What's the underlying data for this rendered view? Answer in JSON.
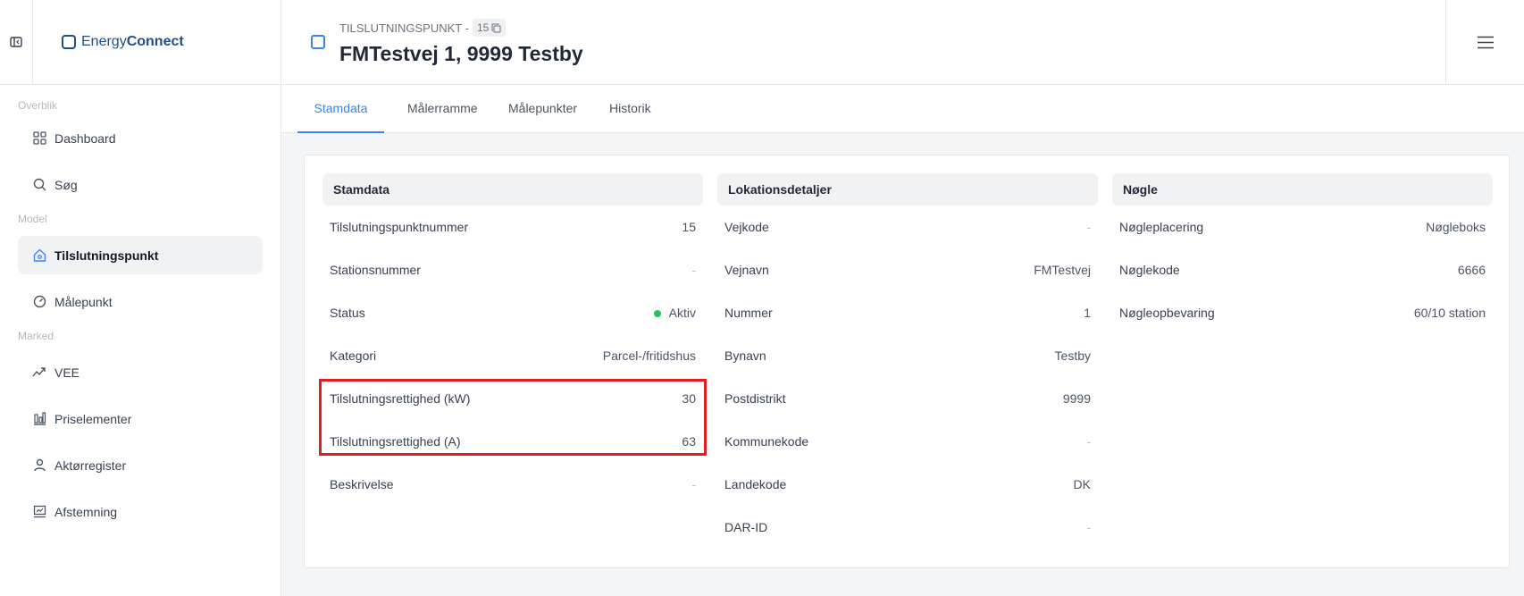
{
  "app": {
    "logo_light": "Energy",
    "logo_bold": "Connect"
  },
  "sidebar": {
    "sections": {
      "overview": "Overblik",
      "model": "Model",
      "market": "Marked"
    },
    "items": [
      {
        "label": "Dashboard",
        "icon": "grid-icon"
      },
      {
        "label": "Søg",
        "icon": "search-icon"
      },
      {
        "label": "Tilslutningspunkt",
        "icon": "home-icon",
        "active": true
      },
      {
        "label": "Målepunkt",
        "icon": "gauge-icon"
      },
      {
        "label": "VEE",
        "icon": "trend-icon"
      },
      {
        "label": "Priselementer",
        "icon": "bars-icon"
      },
      {
        "label": "Aktørregister",
        "icon": "user-icon"
      },
      {
        "label": "Afstemning",
        "icon": "monitor-icon"
      }
    ]
  },
  "header": {
    "subtitle": "TILSLUTNINGSPUNKT -",
    "id": "15",
    "title": "FMTestvej 1, 9999 Testby"
  },
  "tabs": [
    "Stamdata",
    "Målerramme",
    "Målepunkter",
    "Historik"
  ],
  "stamdata": {
    "title": "Stamdata",
    "rows": [
      {
        "label": "Tilslutningspunktnummer",
        "value": "15"
      },
      {
        "label": "Stationsnummer",
        "value": "-"
      },
      {
        "label": "Status",
        "value": "Aktiv"
      },
      {
        "label": "Kategori",
        "value": "Parcel-/fritidshus"
      },
      {
        "label": "Tilslutningsrettighed (kW)",
        "value": "30"
      },
      {
        "label": "Tilslutningsrettighed (A)",
        "value": "63"
      },
      {
        "label": "Beskrivelse",
        "value": "-"
      }
    ]
  },
  "lokation": {
    "title": "Lokationsdetaljer",
    "rows": [
      {
        "label": "Vejkode",
        "value": "-"
      },
      {
        "label": "Vejnavn",
        "value": "FMTestvej"
      },
      {
        "label": "Nummer",
        "value": "1"
      },
      {
        "label": "Bynavn",
        "value": "Testby"
      },
      {
        "label": "Postdistrikt",
        "value": "9999"
      },
      {
        "label": "Kommunekode",
        "value": "-"
      },
      {
        "label": "Landekode",
        "value": "DK"
      },
      {
        "label": "DAR-ID",
        "value": "-"
      }
    ]
  },
  "noegle": {
    "title": "Nøgle",
    "rows": [
      {
        "label": "Nøgleplacering",
        "value": "Nøgleboks"
      },
      {
        "label": "Nøglekode",
        "value": "6666"
      },
      {
        "label": "Nøgleopbevaring",
        "value": "60/10 station"
      }
    ]
  },
  "colors": {
    "accent": "#3b82f6",
    "brand": "#1e4f87",
    "status_active": "#22c55e",
    "highlight": "#e11d22"
  }
}
